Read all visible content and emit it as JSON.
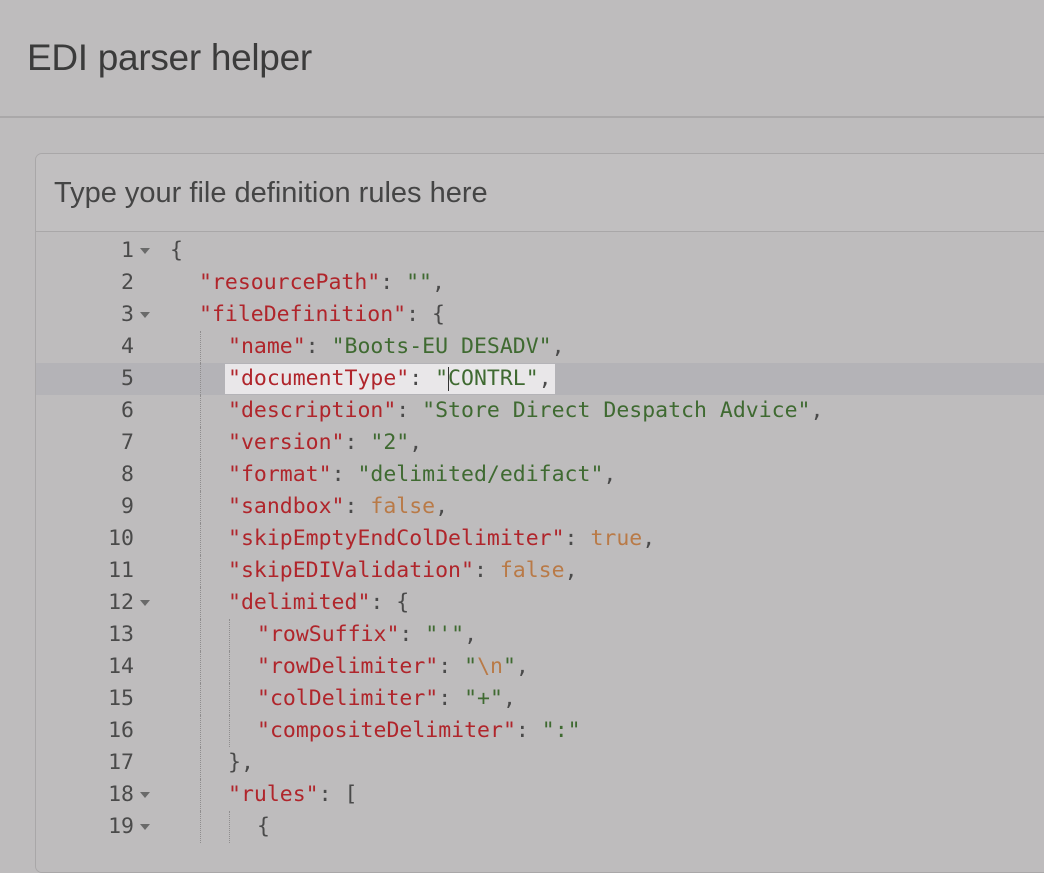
{
  "app": {
    "title": "EDI parser helper"
  },
  "editor_panel": {
    "placeholder": "Type your file definition rules here",
    "active_line": 5,
    "lines": [
      {
        "n": "1",
        "fold": true,
        "indent": 0,
        "tokens": [
          [
            "p",
            "{"
          ]
        ]
      },
      {
        "n": "2",
        "fold": false,
        "indent": 1,
        "tokens": [
          [
            "k",
            "\"resourcePath\""
          ],
          [
            "p",
            ": "
          ],
          [
            "s",
            "\"\""
          ],
          [
            "p",
            ","
          ]
        ]
      },
      {
        "n": "3",
        "fold": true,
        "indent": 1,
        "tokens": [
          [
            "k",
            "\"fileDefinition\""
          ],
          [
            "p",
            ": {"
          ]
        ]
      },
      {
        "n": "4",
        "fold": false,
        "indent": 2,
        "tokens": [
          [
            "k",
            "\"name\""
          ],
          [
            "p",
            ": "
          ],
          [
            "s",
            "\"Boots-EU DESADV\""
          ],
          [
            "p",
            ","
          ]
        ]
      },
      {
        "n": "5",
        "fold": false,
        "indent": 2,
        "tokens": [
          [
            "k",
            "\"documentType\""
          ],
          [
            "p",
            ": "
          ],
          [
            "s",
            "\"CONTRL\""
          ],
          [
            "p",
            ","
          ]
        ]
      },
      {
        "n": "6",
        "fold": false,
        "indent": 2,
        "tokens": [
          [
            "k",
            "\"description\""
          ],
          [
            "p",
            ": "
          ],
          [
            "s",
            "\"Store Direct Despatch Advice\""
          ],
          [
            "p",
            ","
          ]
        ]
      },
      {
        "n": "7",
        "fold": false,
        "indent": 2,
        "tokens": [
          [
            "k",
            "\"version\""
          ],
          [
            "p",
            ": "
          ],
          [
            "s",
            "\"2\""
          ],
          [
            "p",
            ","
          ]
        ]
      },
      {
        "n": "8",
        "fold": false,
        "indent": 2,
        "tokens": [
          [
            "k",
            "\"format\""
          ],
          [
            "p",
            ": "
          ],
          [
            "s",
            "\"delimited/edifact\""
          ],
          [
            "p",
            ","
          ]
        ]
      },
      {
        "n": "9",
        "fold": false,
        "indent": 2,
        "tokens": [
          [
            "k",
            "\"sandbox\""
          ],
          [
            "p",
            ": "
          ],
          [
            "c",
            "false"
          ],
          [
            "p",
            ","
          ]
        ]
      },
      {
        "n": "10",
        "fold": false,
        "indent": 2,
        "tokens": [
          [
            "k",
            "\"skipEmptyEndColDelimiter\""
          ],
          [
            "p",
            ": "
          ],
          [
            "c",
            "true"
          ],
          [
            "p",
            ","
          ]
        ]
      },
      {
        "n": "11",
        "fold": false,
        "indent": 2,
        "tokens": [
          [
            "k",
            "\"skipEDIValidation\""
          ],
          [
            "p",
            ": "
          ],
          [
            "c",
            "false"
          ],
          [
            "p",
            ","
          ]
        ]
      },
      {
        "n": "12",
        "fold": true,
        "indent": 2,
        "tokens": [
          [
            "k",
            "\"delimited\""
          ],
          [
            "p",
            ": {"
          ]
        ]
      },
      {
        "n": "13",
        "fold": false,
        "indent": 3,
        "tokens": [
          [
            "k",
            "\"rowSuffix\""
          ],
          [
            "p",
            ": "
          ],
          [
            "s",
            "\"'\""
          ],
          [
            "p",
            ","
          ]
        ]
      },
      {
        "n": "14",
        "fold": false,
        "indent": 3,
        "tokens": [
          [
            "k",
            "\"rowDelimiter\""
          ],
          [
            "p",
            ": "
          ],
          [
            "s",
            "\""
          ],
          [
            "c",
            "\\n"
          ],
          [
            "s",
            "\""
          ],
          [
            "p",
            ","
          ]
        ]
      },
      {
        "n": "15",
        "fold": false,
        "indent": 3,
        "tokens": [
          [
            "k",
            "\"colDelimiter\""
          ],
          [
            "p",
            ": "
          ],
          [
            "s",
            "\"+\""
          ],
          [
            "p",
            ","
          ]
        ]
      },
      {
        "n": "16",
        "fold": false,
        "indent": 3,
        "tokens": [
          [
            "k",
            "\"compositeDelimiter\""
          ],
          [
            "p",
            ": "
          ],
          [
            "s",
            "\":\""
          ]
        ]
      },
      {
        "n": "17",
        "fold": false,
        "indent": 2,
        "tokens": [
          [
            "p",
            "},"
          ]
        ]
      },
      {
        "n": "18",
        "fold": true,
        "indent": 2,
        "tokens": [
          [
            "k",
            "\"rules\""
          ],
          [
            "p",
            ": ["
          ]
        ]
      },
      {
        "n": "19",
        "fold": true,
        "indent": 3,
        "tokens": [
          [
            "p",
            "{"
          ]
        ]
      }
    ]
  }
}
